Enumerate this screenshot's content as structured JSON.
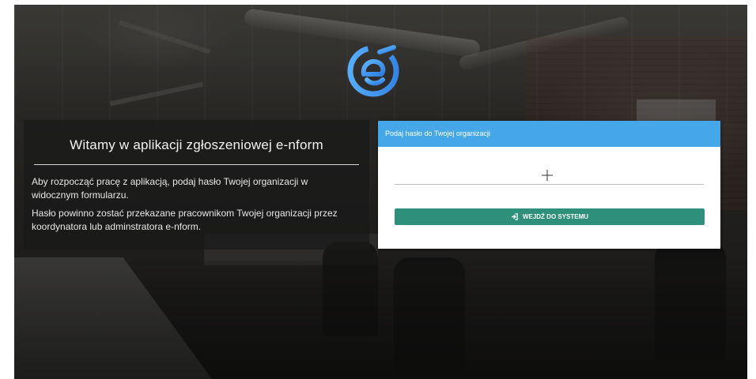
{
  "welcome": {
    "title": "Witamy w aplikacji zgłoszeniowej e-nform",
    "paragraph1": "Aby rozpocząć pracę z aplikacją, podaj hasło Twojej organizacji w widocznym formularzu.",
    "paragraph2": "Hasło powinno zostać przekazane pracownikom Twojej organizacji przez koordynatora lub adminstratora e-nform."
  },
  "login": {
    "header": "Podaj hasło do Twojej organizacji",
    "password_value": "",
    "submit_label": "WEJDŹ DO SYSTEMU",
    "submit_icon": "sign-in-icon"
  },
  "colors": {
    "header_blue": "#45a7e8",
    "button_green": "#2e8f7a",
    "logo_blue": "#3b8fe8"
  },
  "logo": {
    "icon": "e-nform-logo-icon"
  }
}
